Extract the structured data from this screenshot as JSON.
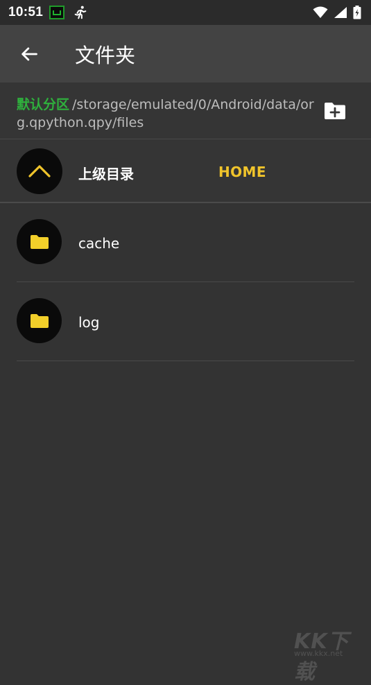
{
  "status_bar": {
    "time": "10:51",
    "icons": [
      "app-notification-icon",
      "running-man-icon",
      "wifi-icon",
      "cellular-signal-icon",
      "battery-charging-icon"
    ]
  },
  "app_bar": {
    "back_icon": "arrow-left-icon",
    "title": "文件夹"
  },
  "path_bar": {
    "label": "默认分区",
    "path": "/storage/emulated/0/Android/data/org.qpython.qpy/files",
    "new_folder_icon": "folder-plus-icon"
  },
  "up_directory": {
    "icon": "chevron-up-icon",
    "label": "上级目录",
    "home_label": "HOME"
  },
  "files": [
    {
      "name": "cache",
      "icon": "folder-icon"
    },
    {
      "name": "log",
      "icon": "folder-icon"
    }
  ],
  "watermark": {
    "brand": "KK下载",
    "url": "www.kkx.net"
  },
  "colors": {
    "background": "#333333",
    "app_bar": "#434343",
    "status_bar": "#2b2b2b",
    "accent_green": "#2fb13d",
    "accent_yellow": "#f0c42b",
    "folder_yellow": "#f2cf2a"
  }
}
